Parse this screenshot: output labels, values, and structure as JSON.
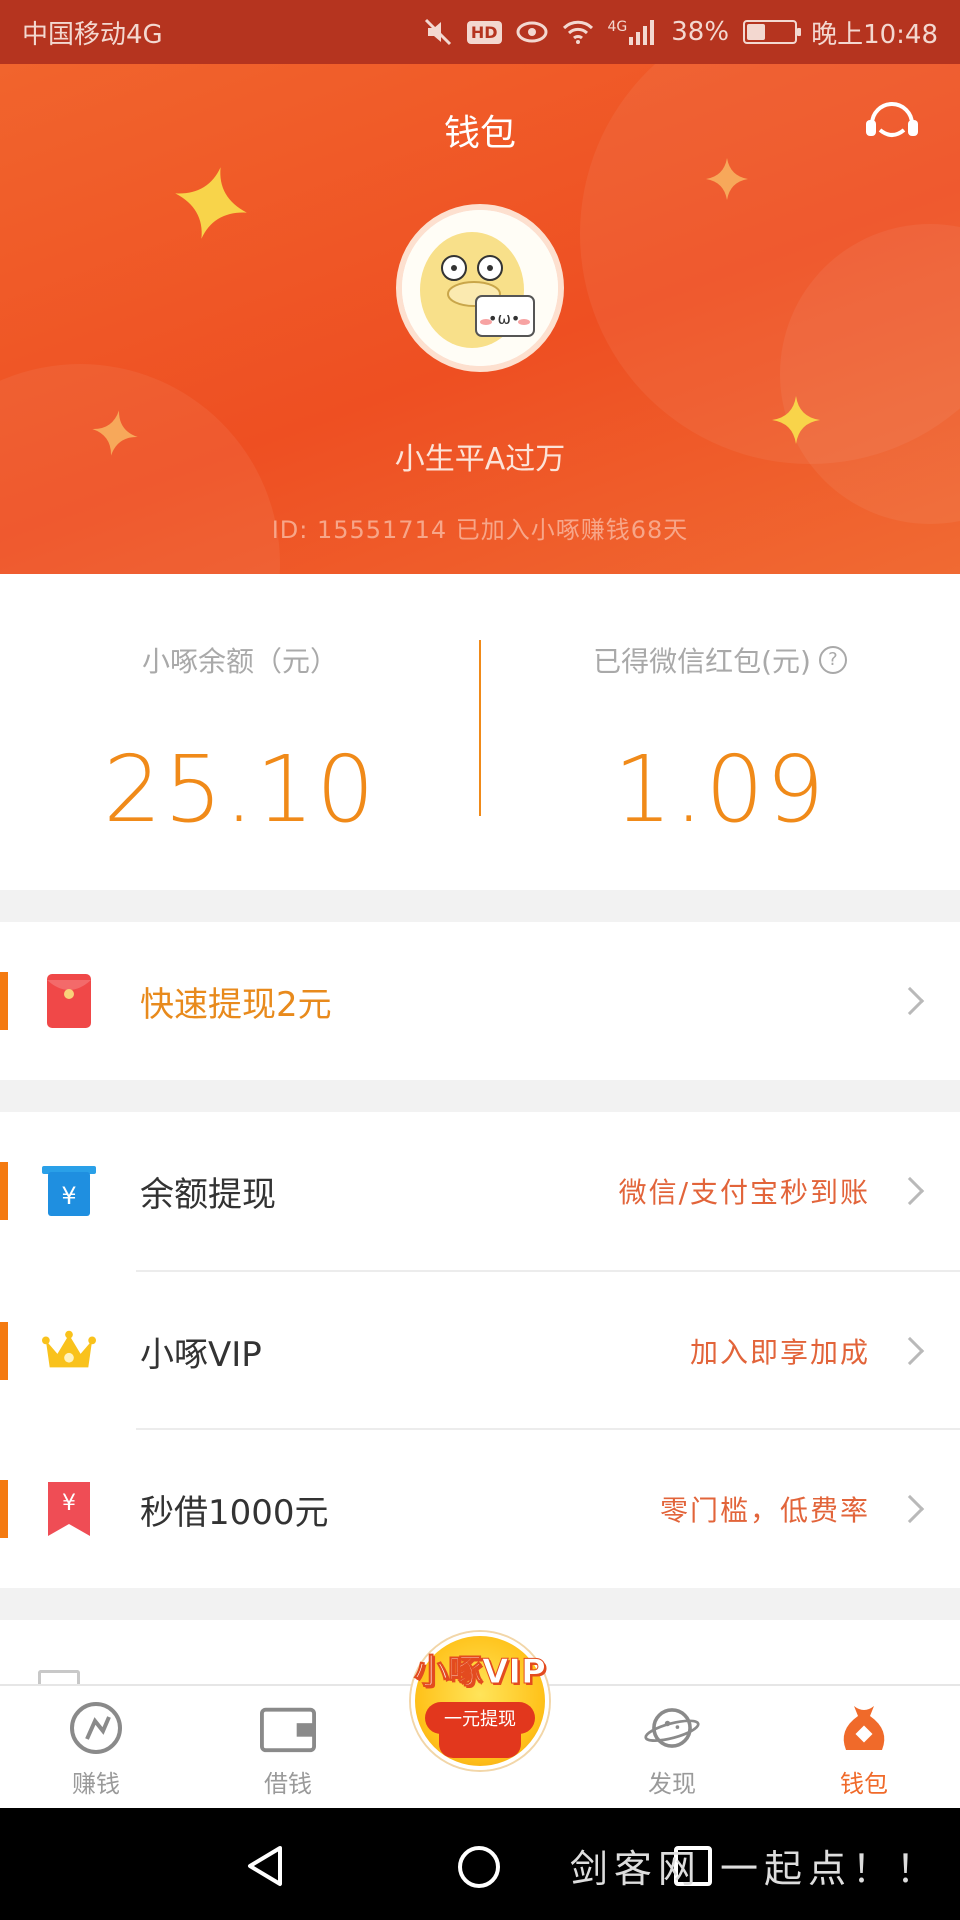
{
  "status_bar": {
    "carrier": "中国移动4G",
    "battery": "38%",
    "battery_level": 0.38,
    "time": "晚上10:48",
    "hd_badge": "HD",
    "signal_label": "4G"
  },
  "header": {
    "title": "钱包",
    "nickname": "小生平A过万",
    "user_meta": "ID: 15551714   已加入小啄赚钱68天",
    "service_icon": "customer-service-icon"
  },
  "balances": {
    "xiaozhuo_label": "小啄余额（元）",
    "xiaozhuo_value": "25.10",
    "wechat_label": "已得微信红包(元)",
    "wechat_value": "1.09",
    "help_symbol": "?"
  },
  "quick_withdraw": {
    "label": "快速提现2元"
  },
  "menu": [
    {
      "label": "余额提现",
      "hint": "微信/支付宝秒到账",
      "icon": "yuan-wallet-icon"
    },
    {
      "label": "小啄VIP",
      "hint": "加入即享加成",
      "icon": "crown-icon"
    },
    {
      "label": "秒借1000元",
      "hint": "零门槛，低费率",
      "icon": "yuan-tag-icon"
    }
  ],
  "tabbar": {
    "tabs": [
      {
        "label": "赚钱",
        "icon": "earn-icon",
        "active": false
      },
      {
        "label": "借钱",
        "icon": "wallet-card-icon",
        "active": false
      },
      {
        "label": "发现",
        "icon": "planet-icon",
        "active": false
      },
      {
        "label": "钱包",
        "icon": "money-bag-icon",
        "active": true
      }
    ],
    "vip_badge_title": "小啄VIP",
    "vip_badge_sub": "一元提现"
  },
  "watermark": "剑客网 一起点！！",
  "colors": {
    "accent_orange": "#f08a19",
    "header_red": "#ee4f22",
    "status_bar": "#b5341f",
    "active_tab": "#f06a2a"
  }
}
